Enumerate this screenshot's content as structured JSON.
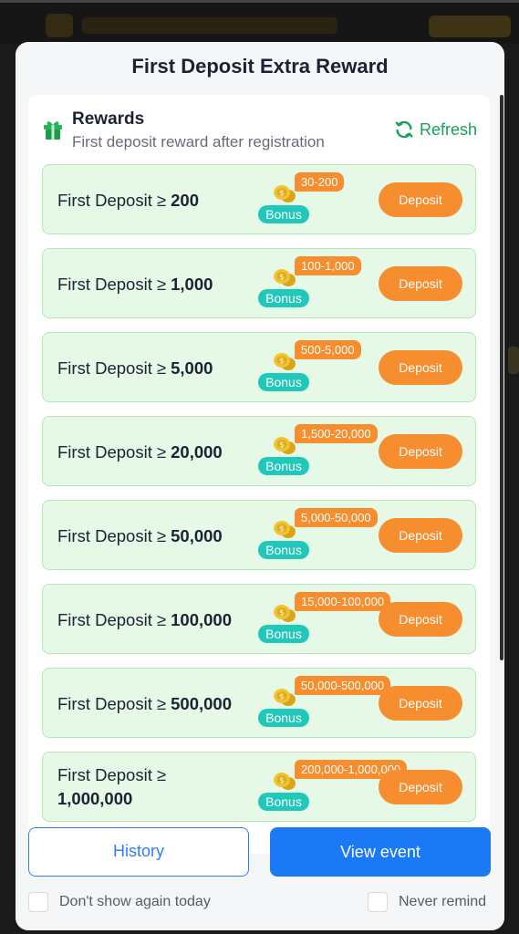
{
  "modal": {
    "title": "First Deposit Extra Reward"
  },
  "rewards": {
    "title": "Rewards",
    "subtitle": "First deposit reward after registration",
    "refresh_label": "Refresh"
  },
  "tiers": [
    {
      "prefix": "First Deposit ≥",
      "amount": "200",
      "range": "30-200",
      "bonus": "Bonus",
      "button": "Deposit"
    },
    {
      "prefix": "First Deposit ≥",
      "amount": "1,000",
      "range": "100-1,000",
      "bonus": "Bonus",
      "button": "Deposit"
    },
    {
      "prefix": "First Deposit ≥",
      "amount": "5,000",
      "range": "500-5,000",
      "bonus": "Bonus",
      "button": "Deposit"
    },
    {
      "prefix": "First Deposit ≥",
      "amount": "20,000",
      "range": "1,500-20,000",
      "bonus": "Bonus",
      "button": "Deposit"
    },
    {
      "prefix": "First Deposit ≥",
      "amount": "50,000",
      "range": "5,000-50,000",
      "bonus": "Bonus",
      "button": "Deposit"
    },
    {
      "prefix": "First Deposit ≥",
      "amount": "100,000",
      "range": "15,000-100,000",
      "bonus": "Bonus",
      "button": "Deposit"
    },
    {
      "prefix": "First Deposit ≥",
      "amount": "500,000",
      "range": "50,000-500,000",
      "bonus": "Bonus",
      "button": "Deposit"
    },
    {
      "prefix": "First Deposit ≥",
      "amount": "1,000,000",
      "range": "200,000-1,000,000",
      "bonus": "Bonus",
      "button": "Deposit"
    }
  ],
  "footer": {
    "history_label": "History",
    "view_event_label": "View event",
    "dont_show_label": "Don't show again today",
    "never_remind_label": "Never remind"
  },
  "colors": {
    "accent_orange": "#f68e2f",
    "accent_blue": "#1b79f5",
    "bonus_teal": "#1fc8b8",
    "refresh_green": "#18a05a",
    "card_bg": "#e6f8e6"
  }
}
